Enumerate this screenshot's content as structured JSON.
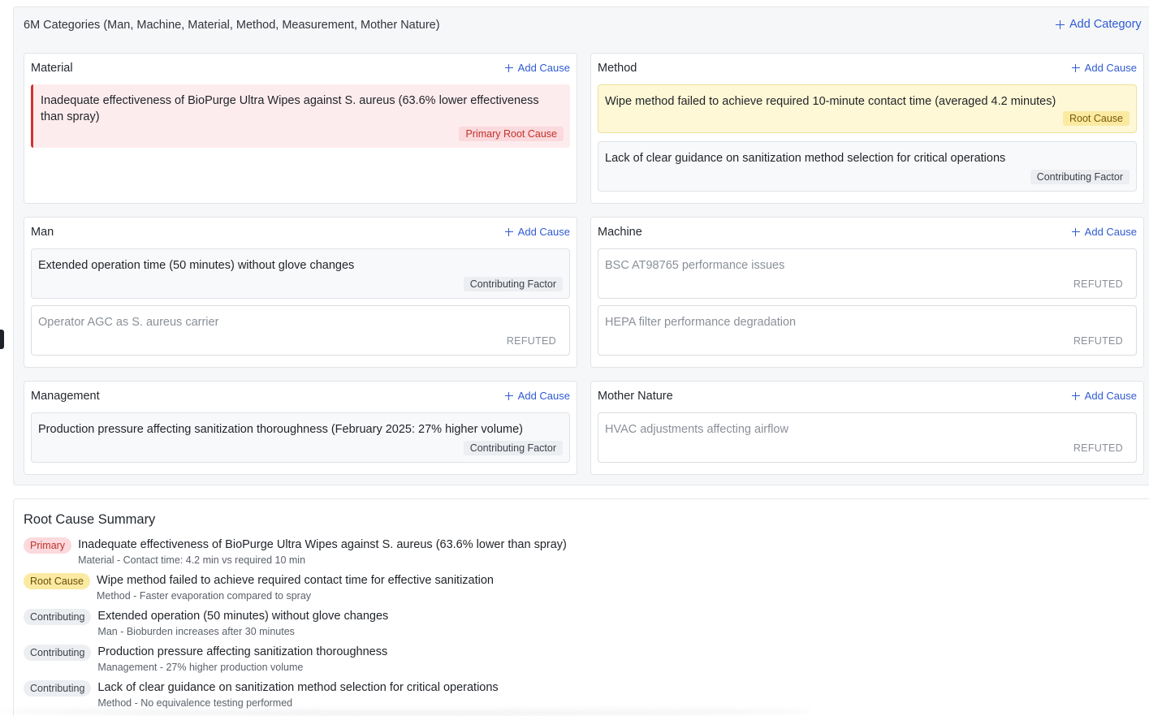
{
  "categories_panel": {
    "title": "6M Categories (Man, Machine, Material, Method, Measurement, Mother Nature)",
    "add_category_label": "Add Category",
    "add_cause_label": "Add Cause",
    "categories": [
      {
        "name": "Material",
        "causes": [
          {
            "text": "Inadequate effectiveness of BioPurge Ultra Wipes against S. aureus (63.6% lower effectiveness than spray)",
            "tag": "Primary Root Cause",
            "kind": "primary"
          }
        ]
      },
      {
        "name": "Method",
        "causes": [
          {
            "text": "Wipe method failed to achieve required 10-minute contact time (averaged 4.2 minutes)",
            "tag": "Root Cause",
            "kind": "root"
          },
          {
            "text": "Lack of clear guidance on sanitization method selection for critical operations",
            "tag": "Contributing Factor",
            "kind": "contrib"
          }
        ]
      },
      {
        "name": "Man",
        "causes": [
          {
            "text": "Extended operation time (50 minutes) without glove changes",
            "tag": "Contributing Factor",
            "kind": "contrib"
          },
          {
            "text": "Operator AGC as S. aureus carrier",
            "tag": "REFUTED",
            "kind": "refuted"
          }
        ]
      },
      {
        "name": "Machine",
        "causes": [
          {
            "text": "BSC AT98765 performance issues",
            "tag": "REFUTED",
            "kind": "refuted"
          },
          {
            "text": "HEPA filter performance degradation",
            "tag": "REFUTED",
            "kind": "refuted"
          }
        ]
      },
      {
        "name": "Management",
        "causes": [
          {
            "text": "Production pressure affecting sanitization thoroughness (February 2025: 27% higher volume)",
            "tag": "Contributing Factor",
            "kind": "contrib"
          }
        ]
      },
      {
        "name": "Mother Nature",
        "causes": [
          {
            "text": "HVAC adjustments affecting airflow",
            "tag": "REFUTED",
            "kind": "refuted"
          }
        ]
      }
    ]
  },
  "summary": {
    "title": "Root Cause Summary",
    "items": [
      {
        "badge": "Primary",
        "kind": "primary",
        "text": "Inadequate effectiveness of BioPurge Ultra Wipes against S. aureus (63.6% lower than spray)",
        "detail": "Material - Contact time: 4.2 min vs required 10 min"
      },
      {
        "badge": "Root Cause",
        "kind": "root",
        "text": "Wipe method failed to achieve required contact time for effective sanitization",
        "detail": "Method - Faster evaporation compared to spray"
      },
      {
        "badge": "Contributing",
        "kind": "contrib",
        "text": "Extended operation (50 minutes) without glove changes",
        "detail": "Man - Bioburden increases after 30 minutes"
      },
      {
        "badge": "Contributing",
        "kind": "contrib",
        "text": "Production pressure affecting sanitization thoroughness",
        "detail": "Management - 27% higher production volume"
      },
      {
        "badge": "Contributing",
        "kind": "contrib",
        "text": "Lack of clear guidance on sanitization method selection for critical operations",
        "detail": "Method - No equivalence testing performed"
      }
    ]
  }
}
